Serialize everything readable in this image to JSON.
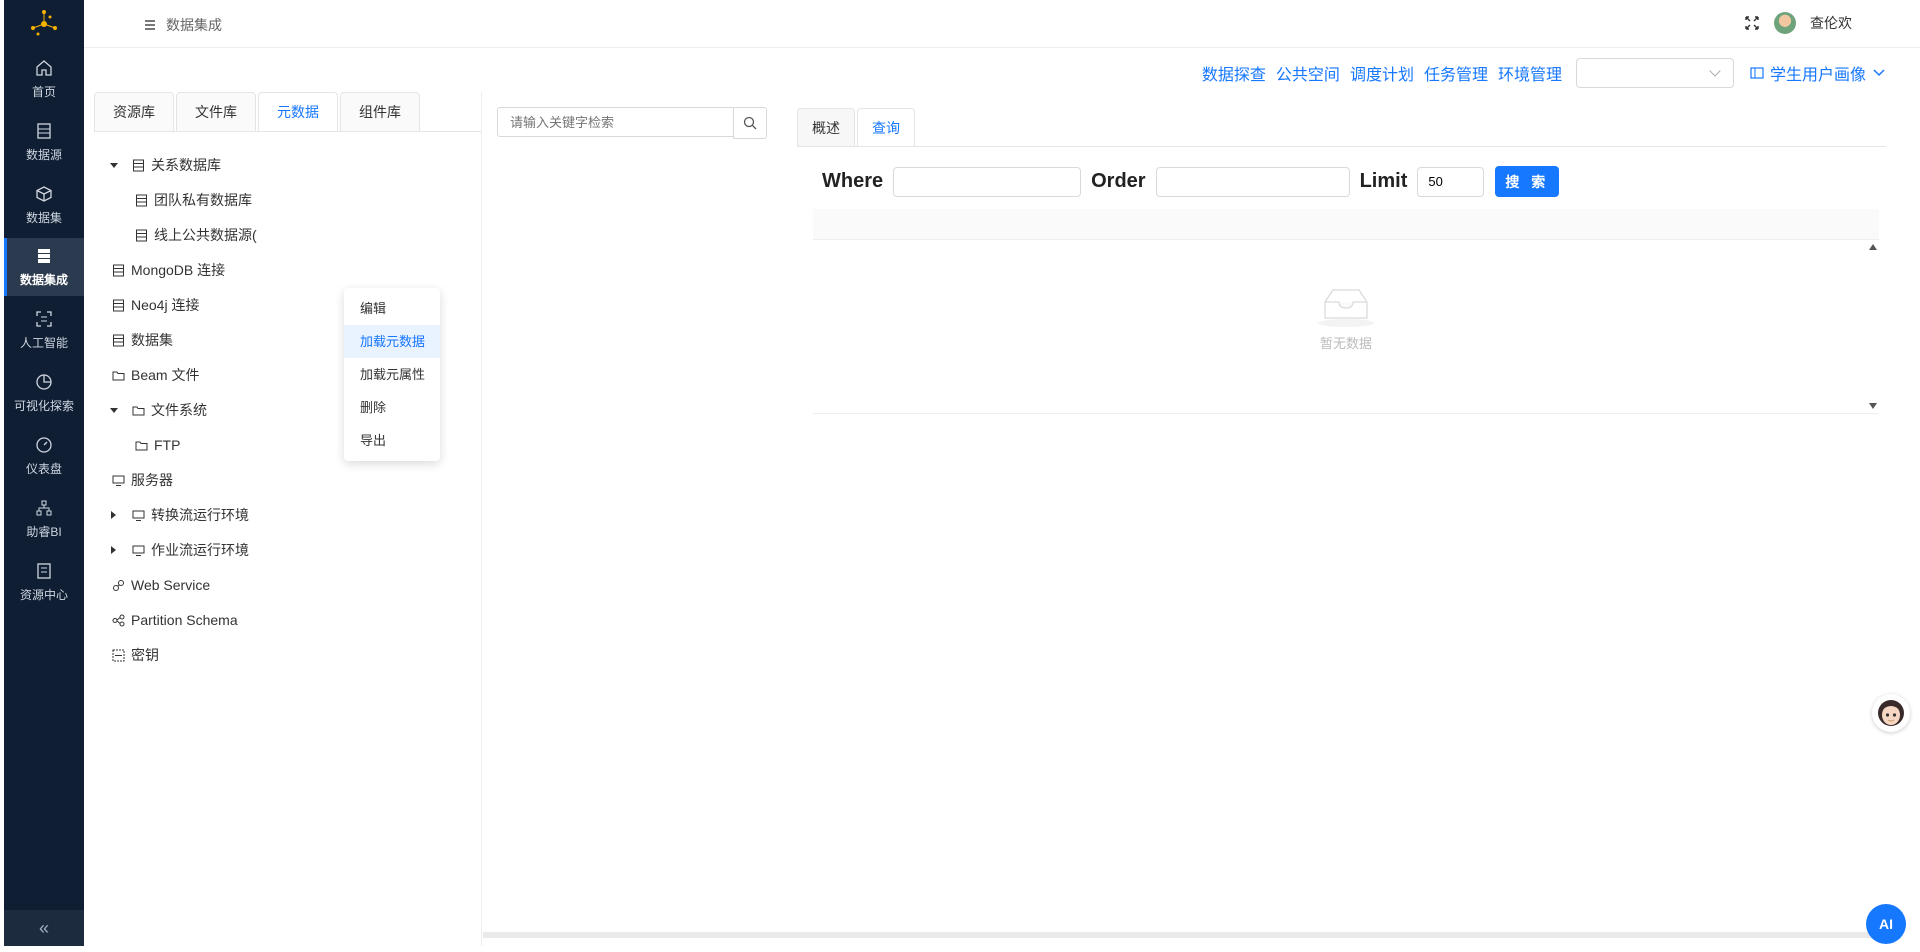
{
  "sidebar": {
    "items": [
      {
        "label": "首页",
        "icon": "home-icon"
      },
      {
        "label": "数据源",
        "icon": "database-icon"
      },
      {
        "label": "数据集",
        "icon": "cube-icon"
      },
      {
        "label": "数据集成",
        "icon": "server-icon"
      },
      {
        "label": "人工智能",
        "icon": "scan-icon"
      },
      {
        "label": "可视化探索",
        "icon": "pie-chart-icon"
      },
      {
        "label": "仪表盘",
        "icon": "dashboard-icon"
      },
      {
        "label": "助睿BI",
        "icon": "org-chart-icon"
      },
      {
        "label": "资源中心",
        "icon": "resource-icon"
      }
    ],
    "active_index": 3,
    "collapse_label": "«"
  },
  "header": {
    "breadcrumb": "数据集成",
    "username": "查伦欢"
  },
  "toolbar": {
    "links": [
      "数据探查",
      "公共空间",
      "调度计划",
      "任务管理",
      "环境管理"
    ],
    "select_value": "",
    "portrait_label": "学生用户画像"
  },
  "left": {
    "tabs": [
      "资源库",
      "文件库",
      "元数据",
      "组件库"
    ],
    "active_tab": 2,
    "tree": [
      {
        "label": "关系数据库",
        "icon": "database-icon",
        "caret": "down"
      },
      {
        "label": "团队私有数据库",
        "icon": "database-icon",
        "caret": ""
      },
      {
        "label": "线上公共数据源(",
        "icon": "database-icon",
        "caret": ""
      },
      {
        "label": "MongoDB 连接",
        "icon": "database-icon",
        "caret": ""
      },
      {
        "label": "Neo4j 连接",
        "icon": "database-icon",
        "caret": ""
      },
      {
        "label": "数据集",
        "icon": "database-icon",
        "caret": ""
      },
      {
        "label": "Beam 文件",
        "icon": "folder-icon",
        "caret": ""
      },
      {
        "label": "文件系统",
        "icon": "folder-icon",
        "caret": "down"
      },
      {
        "label": "FTP",
        "icon": "folder-icon",
        "caret": ""
      },
      {
        "label": "服务器",
        "icon": "monitor-icon",
        "caret": ""
      },
      {
        "label": "转换流运行环境",
        "icon": "monitor-icon",
        "caret": "right"
      },
      {
        "label": "作业流运行环境",
        "icon": "monitor-icon",
        "caret": "right"
      },
      {
        "label": "Web Service",
        "icon": "link-icon",
        "caret": ""
      },
      {
        "label": "Partition Schema",
        "icon": "partition-icon",
        "caret": ""
      },
      {
        "label": "密钥",
        "icon": "key-icon",
        "caret": ""
      }
    ],
    "context_menu": [
      "编辑",
      "加载元数据",
      "加载元属性",
      "删除",
      "导出"
    ],
    "context_highlight": 1
  },
  "search": {
    "placeholder": "请输入关键字检索"
  },
  "right": {
    "tabs": [
      "概述",
      "查询"
    ],
    "active_tab": 1,
    "where_label": "Where",
    "order_label": "Order",
    "limit_label": "Limit",
    "where_value": "",
    "order_value": "",
    "limit_value": "50",
    "search_button": "搜 索",
    "empty_text": "暂无数据"
  },
  "ai_button": "AI",
  "colors": {
    "accent": "#1677ff",
    "sidebar_bg": "#0f1e33"
  }
}
